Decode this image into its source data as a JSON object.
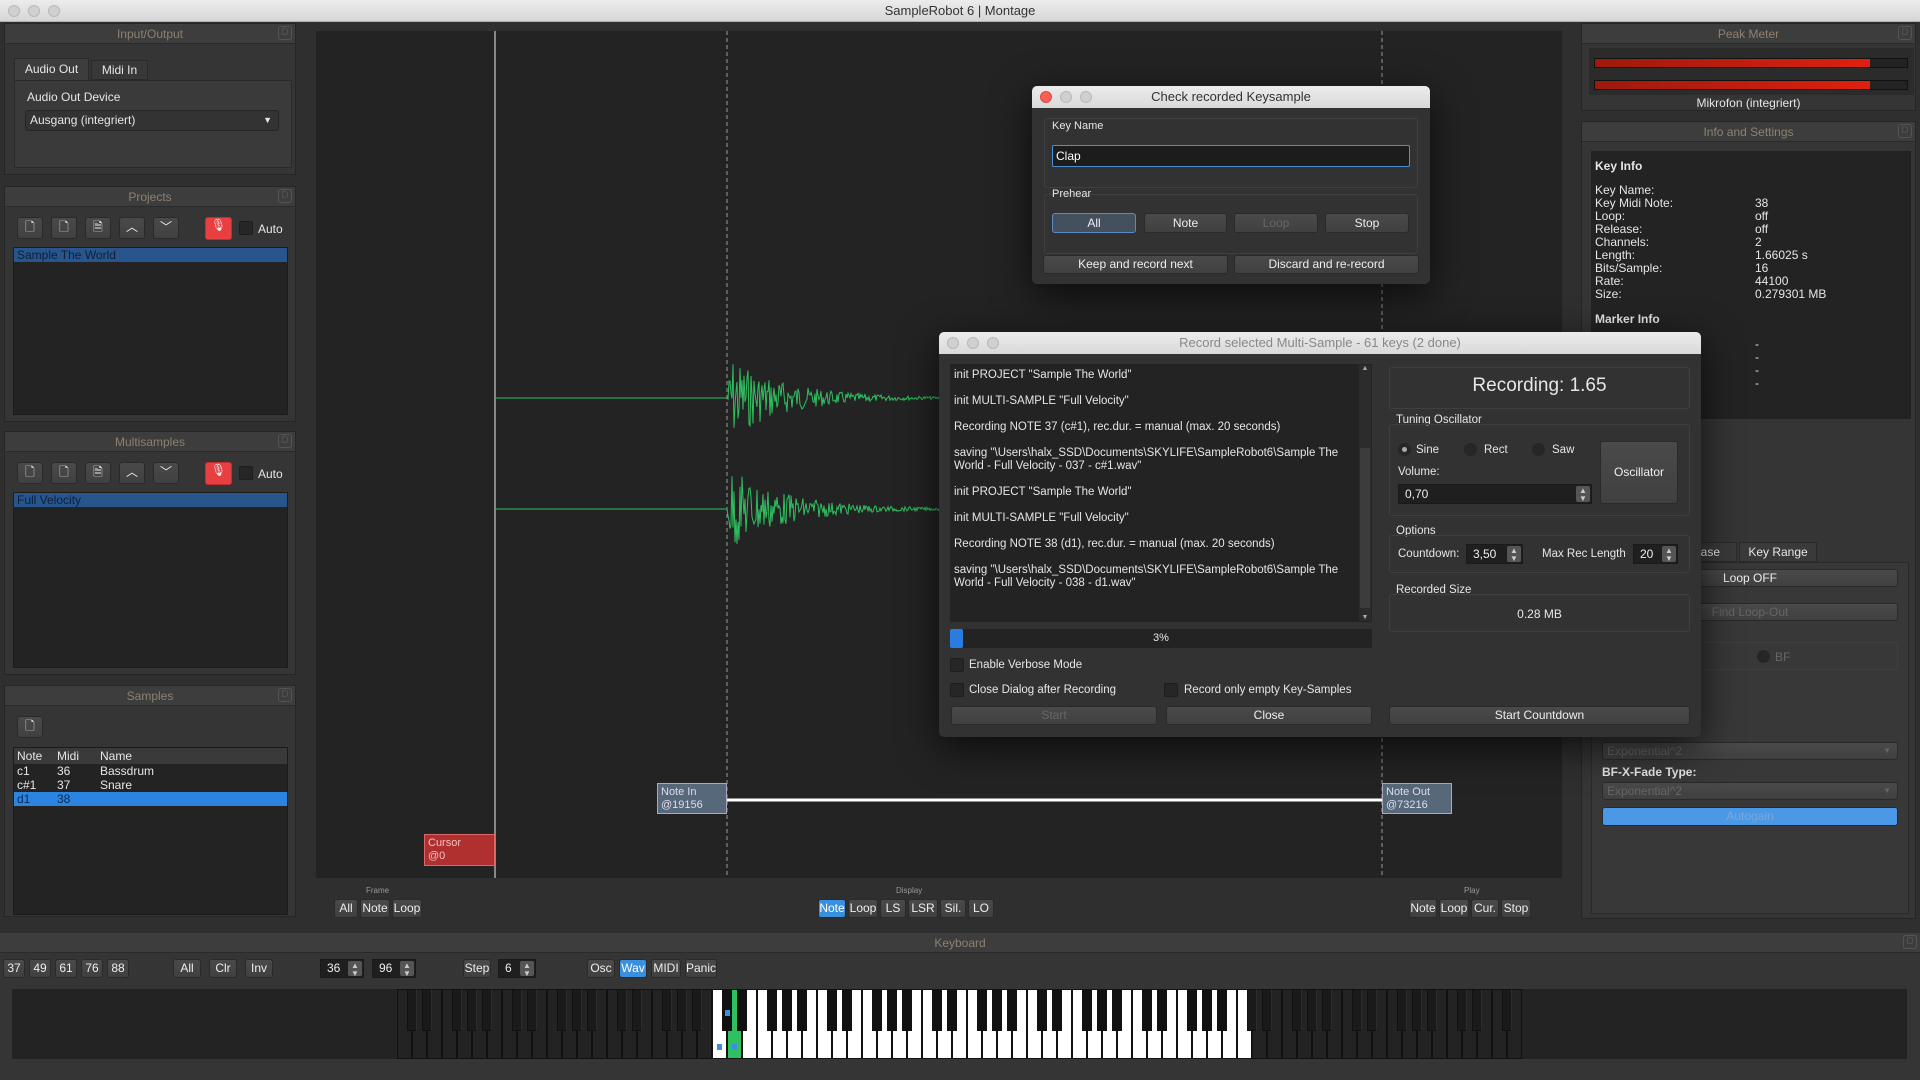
{
  "window": {
    "title": "SampleRobot 6 | Montage"
  },
  "io": {
    "header": "Input/Output",
    "tabs": [
      "Audio Out",
      "Midi In"
    ],
    "device_label": "Audio Out Device",
    "device_value": "Ausgang (integriert)"
  },
  "projects": {
    "header": "Projects",
    "auto": "Auto",
    "items": [
      "Sample The World"
    ]
  },
  "multisamples": {
    "header": "Multisamples",
    "auto": "Auto",
    "items": [
      "Full Velocity"
    ]
  },
  "samples": {
    "header": "Samples",
    "columns": [
      "Note",
      "Midi",
      "Name"
    ],
    "rows": [
      [
        "c1",
        "36",
        "Bassdrum"
      ],
      [
        "c#1",
        "37",
        "Snare"
      ],
      [
        "d1",
        "38",
        ""
      ]
    ]
  },
  "editor": {
    "cursor": [
      "Cursor",
      "@0"
    ],
    "note_in": [
      "Note In",
      "@19156"
    ],
    "note_out": [
      "Note Out",
      "@73216"
    ],
    "waveform_color": "#2fc060"
  },
  "toolbar": {
    "frame_label": "Frame",
    "frame": [
      "All",
      "Note",
      "Loop"
    ],
    "display_label": "Display",
    "display": [
      "Note",
      "Loop",
      "LS",
      "LSR",
      "Sil.",
      "LO"
    ],
    "display_active": "Note",
    "play_label": "Play",
    "play": [
      "Note",
      "Loop",
      "Cur.",
      "Stop"
    ]
  },
  "keyboard": {
    "header": "Keyboard",
    "presets": [
      "37",
      "49",
      "61",
      "76",
      "88"
    ],
    "sel": [
      "All",
      "Clr",
      "Inv"
    ],
    "low": "36",
    "high": "96",
    "step_label": "Step",
    "step": "6",
    "modes": [
      "Osc",
      "Wav",
      "MIDI",
      "Panic"
    ],
    "mode_active": "Wav",
    "range": [
      36,
      96
    ],
    "pressed": 38,
    "assigned": [
      36,
      37,
      38
    ]
  },
  "peak": {
    "header": "Peak Meter",
    "levels": [
      0.88,
      0.88
    ],
    "device": "Mikrofon (integriert)",
    "color": "#e0200f"
  },
  "info": {
    "header": "Info and Settings",
    "key_info_title": "Key Info",
    "rows": [
      [
        "Key Name:",
        ""
      ],
      [
        "Key Midi Note:",
        "38"
      ],
      [
        "Loop:",
        "off"
      ],
      [
        "Release:",
        "off"
      ],
      [
        "Channels:",
        "2"
      ],
      [
        "Length:",
        "1.66025 s"
      ],
      [
        "Bits/Sample:",
        "16"
      ],
      [
        "Rate:",
        "44100"
      ],
      [
        "Size:",
        "0.279301 MB"
      ]
    ],
    "marker_info_title": "Marker Info",
    "marker_values": [
      "-",
      "-",
      "-",
      "-"
    ],
    "tabs": [
      "ease",
      "Key Range"
    ],
    "loop_off": "Loop OFF",
    "find_loop_out": "Find Loop-Out",
    "bf": "BF",
    "fade_value_hidden": "Exponential^2",
    "bf_fade_label": "BF-X-Fade Type:",
    "bf_fade_value": "Exponential^2",
    "autogain": "Autogain"
  },
  "check_dialog": {
    "title": "Check recorded Keysample",
    "key_name_label": "Key Name",
    "key_name_value": "Clap",
    "prehear_label": "Prehear",
    "prehear": [
      "All",
      "Note",
      "Loop",
      "Stop"
    ],
    "keep": "Keep and record next",
    "discard": "Discard and re-record"
  },
  "record_dialog": {
    "title": "Record selected Multi-Sample - 61 keys (2 done)",
    "log": [
      "init PROJECT \"Sample The World\"",
      "init MULTI-SAMPLE \"Full Velocity\"",
      "Recording NOTE 37 (c#1), rec.dur. = manual (max. 20 seconds)",
      "saving \"\\Users\\halx_SSD\\Documents\\SKYLIFE\\SampleRobot6\\Sample The World - Full Velocity - 037 - c#1.wav\"",
      "init PROJECT \"Sample The World\"",
      "init MULTI-SAMPLE \"Full Velocity\"",
      "Recording NOTE 38 (d1), rec.dur. = manual (max. 20 seconds)",
      "saving \"\\Users\\halx_SSD\\Documents\\SKYLIFE\\SampleRobot6\\Sample The World - Full Velocity - 038 - d1.wav\""
    ],
    "progress": 3,
    "progress_text": "3%",
    "verbose": "Enable Verbose Mode",
    "close_after": "Close Dialog after Recording",
    "only_empty": "Record only empty Key-Samples",
    "start": "Start",
    "close": "Close",
    "recording": "Recording: 1.65",
    "tuning_label": "Tuning Oscillator",
    "waves": [
      "Sine",
      "Rect",
      "Saw"
    ],
    "wave_selected": "Sine",
    "volume_label": "Volume:",
    "volume": "0,70",
    "oscillator": "Oscillator",
    "options_label": "Options",
    "countdown_label": "Countdown:",
    "countdown": "3,50",
    "maxrec_label": "Max Rec Length",
    "maxrec": "20",
    "recsize_label": "Recorded Size",
    "recsize": "0.28 MB",
    "start_countdown": "Start Countdown"
  }
}
